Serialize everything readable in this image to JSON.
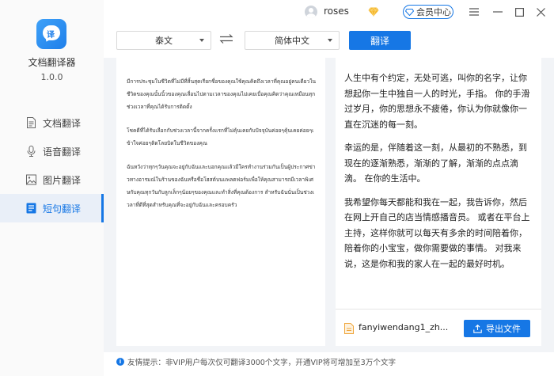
{
  "app": {
    "name": "文档翻译器",
    "version": "1.0.0"
  },
  "nav": {
    "items": [
      {
        "label": "文档翻译",
        "icon": "document-icon",
        "active": false
      },
      {
        "label": "语音翻译",
        "icon": "microphone-icon",
        "active": false
      },
      {
        "label": "图片翻译",
        "icon": "image-icon",
        "active": false
      },
      {
        "label": "短句翻译",
        "icon": "text-icon",
        "active": true
      }
    ]
  },
  "header": {
    "username": "roses",
    "vip_label": "会员中心"
  },
  "toolbar": {
    "source_lang": "泰文",
    "target_lang": "简体中文",
    "translate_label": "翻译"
  },
  "source": {
    "paragraphs": [
      "มีการประชุมในชีวิตที่ไม่มีที่สิ้นสุดเรียกชื่อของคุณใช้คุณคิดถึงเวลาที่คุณอยู่คนเดียวในชีวิตของคุณนั้นนิ้วของคุณเลื่อนไปตามเวลาของคุณไม่เคยเบื่อคุณคิดว่าคุณเหมือนทุกช่วงเวลาที่คุณได้รับการติดตั้ง",
      "โชคดีที่ได้รับเลือกกับช่วงเวลานี้จากครั้งแรกที่ไม่คุ้นเคยกับปัจจุบันค่อยๆคุ้นเคยค่อยๆเข้าใจค่อยๆติดโลยบิดในชีวิตของคุณ",
      "ฉันหวังว่าทุกๆวันคุณจะอยู่กับฉันและบอกคุณแล้วมีใครทำงานร่วมกันเป็นผู้ประกาศข่าวทางอารมณ์ในร้านของฉันหรือชื่อโฮสต์บนแพลตฟอร์มเพื่อให้คุณสามารถมีเวลาพิเศษกับคุณทุกวันกับลูกเล็กๆน้อยๆของคุณและทำสิ่งที่คุณต้องการ สำหรับฉันนั่นเป็นช่วงเวลาที่ดีที่สุดสำหรับคุณที่จะอยู่กับฉันและครอบครัว"
    ]
  },
  "target": {
    "paragraphs": [
      "人生中有个约定，无处可逃，叫你的名字，让你想起你一生中独自一人的时光，手指。 你的手滑过岁月，你的思想永不疲倦，你认为你就像你一直在沉迷的每一刻。",
      "幸运的是，伴随着这一刻，从最初的不熟悉，到现在的逐渐熟悉，渐渐的了解，渐渐的点点滴滴。 在你的生活中。",
      "我希望你每天都能和我在一起，我告诉你，然后在网上开自己的店当情感播音员。 或者在平台上主持，这样你就可以每天有多余的时间陪着你，陪着你的小宝宝，做你需要做的事情。 对我来说，这是你和我的家人在一起的最好时机。"
    ],
    "file_name": "fanyiwendang1_zh...",
    "export_label": "导出文件"
  },
  "footer": {
    "tip": "友情提示：非VIP用户每次仅可翻译3000个文字，开通VIP将可增加至3万个文字"
  },
  "colors": {
    "accent": "#1677e5",
    "vip_diamond": "#f5b82e"
  }
}
